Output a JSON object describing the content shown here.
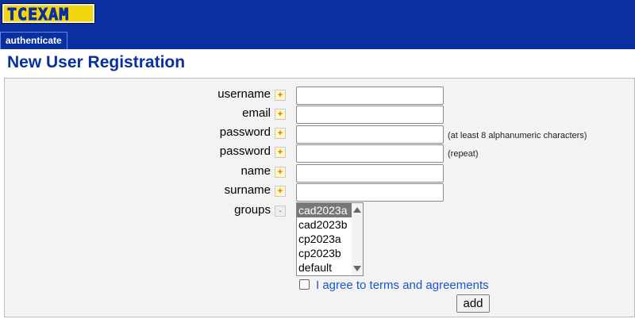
{
  "header": {
    "logo_text": "TCEXAM",
    "tab_label": "authenticate"
  },
  "page_title": "New User Registration",
  "form": {
    "username_label": "username",
    "email_label": "email",
    "password_label": "password",
    "password_hint": "(at least 8 alphanumeric characters)",
    "password_repeat_label": "password",
    "password_repeat_hint": "(repeat)",
    "name_label": "name",
    "surname_label": "surname",
    "groups_label": "groups",
    "required_marker": "+",
    "optional_marker": "-",
    "groups_options": [
      "cad2023a",
      "cad2023b",
      "cp2023a",
      "cp2023b",
      "default"
    ],
    "groups_selected": "cad2023a",
    "agree_label": "I agree to terms and agreements",
    "agree_checked": false,
    "add_label": "add"
  },
  "colors": {
    "header_bg": "#0a2fa0",
    "logo_bg": "#f2d70c",
    "link": "#1a56c9"
  }
}
